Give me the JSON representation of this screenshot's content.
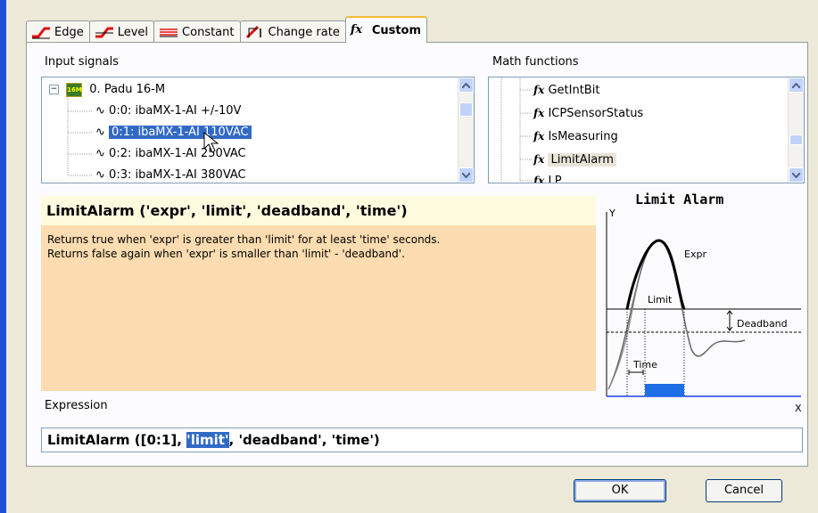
{
  "tabs": [
    {
      "label": "Edge",
      "icon": "edge-icon"
    },
    {
      "label": "Level",
      "icon": "level-icon"
    },
    {
      "label": "Constant",
      "icon": "constant-icon"
    },
    {
      "label": "Change rate",
      "icon": "change-rate-icon"
    },
    {
      "label": "Custom",
      "icon": "function-icon",
      "active": true
    }
  ],
  "input_signals": {
    "label": "Input signals",
    "root": "0. Padu 16-M",
    "root_badge": "16M",
    "items": [
      "0:0: ibaMX-1-AI +/-10V",
      "0:1: ibaMX-1-AI 110VAC",
      "0:2: ibaMX-1-AI 250VAC",
      "0:3: ibaMX-1-AI 380VAC"
    ],
    "selected_index": 1
  },
  "math_functions": {
    "label": "Math functions",
    "fx_glyph": "fx",
    "items": [
      "GetIntBit",
      "ICPSensorStatus",
      "IsMeasuring",
      "LimitAlarm",
      "LP"
    ],
    "highlighted_index": 3
  },
  "description": {
    "signature": "LimitAlarm ('expr', 'limit', 'deadband', 'time')",
    "line1": "Returns true when 'expr' is greater than 'limit' for at least 'time' seconds.",
    "line2": "Returns false again when 'expr' is smaller than 'limit' - 'deadband'."
  },
  "graph": {
    "title": "Limit Alarm",
    "y_label": "Y",
    "x_label": "X",
    "expr_label": "Expr",
    "limit_label": "Limit",
    "deadband_label": "Deadband",
    "time_label": "Time"
  },
  "expression": {
    "label": "Expression",
    "before": "LimitAlarm ([0:1], ",
    "selected": "'limit'",
    "after": ", 'deadband', 'time')"
  },
  "buttons": {
    "ok": "OK",
    "cancel": "Cancel"
  },
  "colors": {
    "selection": "#316ac5",
    "description_bg": "#fcdcb0",
    "signature_bg": "#fffbdf",
    "alarm_fill": "#1e6fe6"
  }
}
